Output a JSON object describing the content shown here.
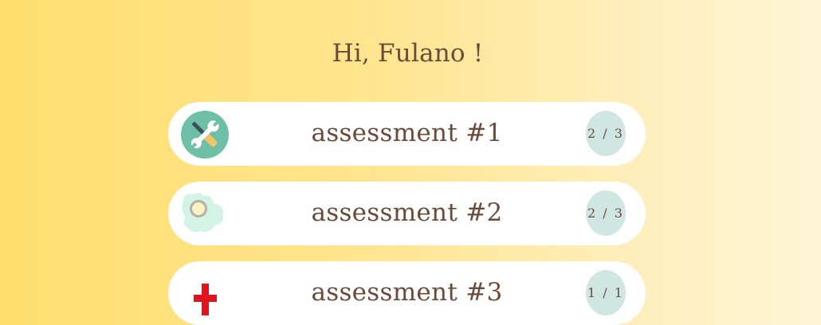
{
  "greeting": "Hi, Fulano !",
  "assessments": [
    {
      "title": "assessment #1",
      "progress": "2 / 3",
      "icon": "tools-icon"
    },
    {
      "title": "assessment #2",
      "progress": "2 / 3",
      "icon": "flower-icon"
    },
    {
      "title": "assessment #3",
      "progress": "1 / 1",
      "icon": "medical-cross-icon"
    }
  ],
  "colors": {
    "text": "#6B4A3A",
    "card": "#FFFFFF",
    "badge": "#CFE6E2",
    "background_left": "#FFDE6E",
    "background_right": "#FFF4D6"
  }
}
